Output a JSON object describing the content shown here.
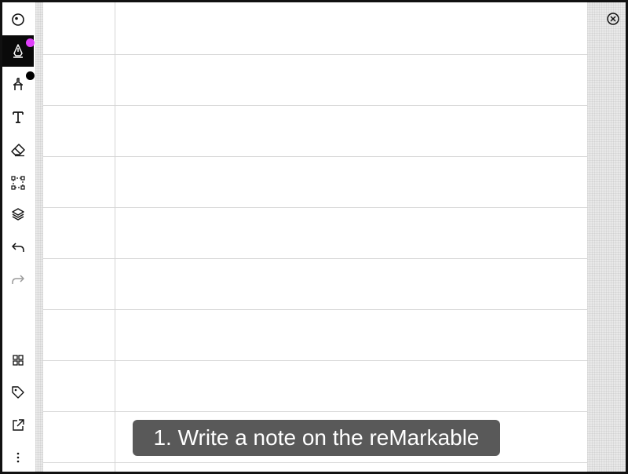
{
  "caption": {
    "text": "1. Write a note on the reMarkable"
  },
  "toolbar": {
    "items": [
      {
        "icon": "menu-circle-icon"
      },
      {
        "icon": "pen-icon",
        "active": true,
        "badge_color": "#e040fb"
      },
      {
        "icon": "highlighter-icon",
        "badge_color": "#000000"
      },
      {
        "icon": "text-tool-icon"
      },
      {
        "icon": "eraser-icon"
      },
      {
        "icon": "selection-icon"
      },
      {
        "icon": "layers-icon"
      },
      {
        "icon": "undo-icon"
      },
      {
        "icon": "redo-icon",
        "disabled": true
      },
      {
        "icon": "grid-view-icon"
      },
      {
        "icon": "tag-icon"
      },
      {
        "icon": "share-icon"
      },
      {
        "icon": "more-vertical-icon"
      }
    ]
  },
  "close": {
    "icon": "close-circle-icon"
  },
  "colors": {
    "active_tool_bg": "#0a0a0a",
    "pen_badge": "#e040fb",
    "highlighter_badge": "#000000",
    "caption_bg": "#4b4b4b",
    "ruled_line": "#d9d9d9"
  }
}
